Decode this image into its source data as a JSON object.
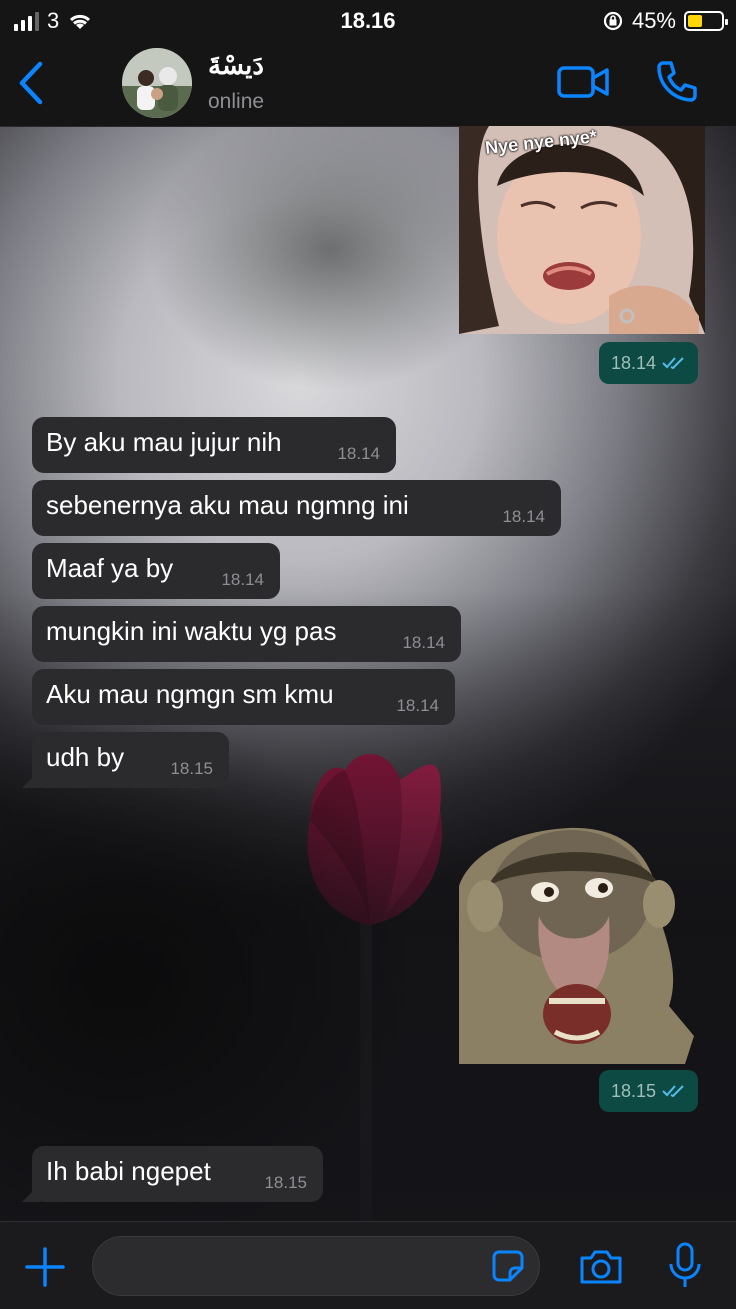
{
  "status_bar": {
    "carrier": "3",
    "time": "18.16",
    "battery_percent": "45%",
    "battery_level": 0.45,
    "battery_color": "#ffd60a"
  },
  "header": {
    "contact_name": "دَيسْةَ",
    "contact_status": "online",
    "accent_color": "#0a84ff"
  },
  "messages": [
    {
      "direction": "outgoing",
      "type": "sticker",
      "caption": "Nye nye nye*",
      "time": "18.14",
      "status": "read"
    },
    {
      "direction": "incoming",
      "text": "By aku mau jujur nih",
      "time": "18.14"
    },
    {
      "direction": "incoming",
      "text": "sebenernya aku mau ngmng ini",
      "time": "18.14"
    },
    {
      "direction": "incoming",
      "text": "Maaf ya by",
      "time": "18.14"
    },
    {
      "direction": "incoming",
      "text": "mungkin ini waktu yg pas",
      "time": "18.14"
    },
    {
      "direction": "incoming",
      "text": "Aku mau ngmgn sm kmu",
      "time": "18.14"
    },
    {
      "direction": "incoming",
      "text": "udh by",
      "time": "18.15"
    },
    {
      "direction": "outgoing",
      "type": "sticker",
      "time": "18.15",
      "status": "read"
    },
    {
      "direction": "incoming",
      "text": "Ih babi ngepet",
      "time": "18.15"
    }
  ],
  "colors": {
    "incoming_bubble": "#2b2b2e",
    "outgoing_time_pill": "#0e4a44",
    "read_tick": "#53bdeb"
  },
  "icons": {
    "back": "chevron-left-icon",
    "video_call": "video-camera-icon",
    "voice_call": "phone-icon",
    "attach": "plus-icon",
    "sticker": "sticker-icon",
    "camera": "camera-icon",
    "mic": "microphone-icon"
  },
  "composer": {
    "value": ""
  }
}
